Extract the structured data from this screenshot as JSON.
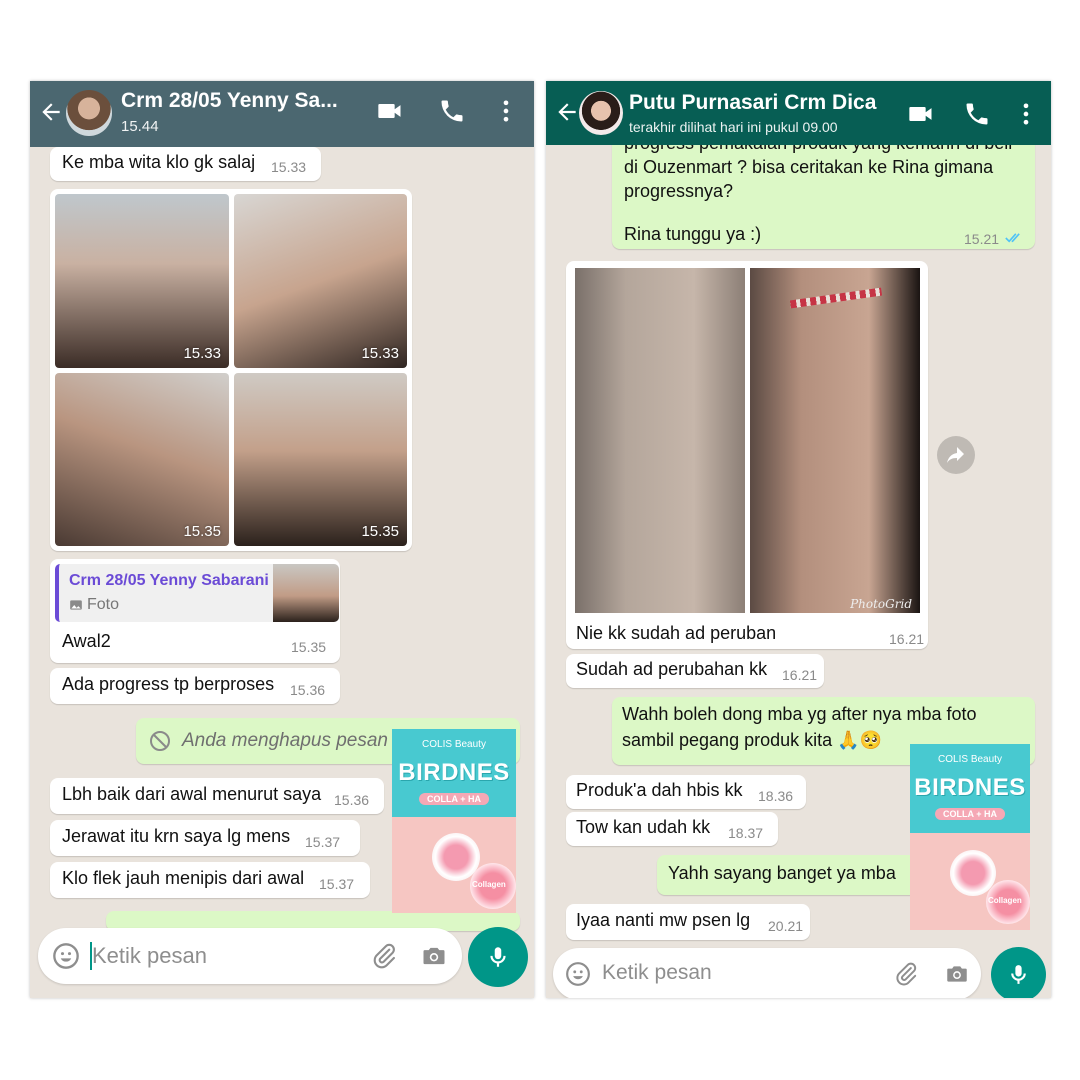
{
  "left": {
    "header": {
      "title": "Crm 28/05 Yenny Sa...",
      "subtitle": "15.44"
    },
    "messages": [
      {
        "text": "Ke mba wita klo gk salaj",
        "time": "15.33"
      },
      {
        "text": "Awal2",
        "time": "15.35"
      },
      {
        "text": "Ada progress tp berproses",
        "time": "15.36"
      },
      {
        "text": "Anda menghapus pesan"
      },
      {
        "text": "Lbh baik dari awal menurut saya",
        "time": "15.36"
      },
      {
        "text": "Jerawat itu krn saya lg mens",
        "time": "15.37"
      },
      {
        "text": "Klo flek jauh menipis dari awal",
        "time": "15.37"
      }
    ],
    "photos": [
      {
        "time": "15.33"
      },
      {
        "time": "15.33"
      },
      {
        "time": "15.35"
      },
      {
        "time": "15.35"
      }
    ],
    "reply": {
      "author": "Crm 28/05 Yenny Sabarani",
      "type": "Foto"
    },
    "input": {
      "placeholder": "Ketik pesan"
    }
  },
  "right": {
    "header": {
      "title": "Putu Purnasari Crm Dica",
      "subtitle": "terakhir dilihat hari ini pukul 09.00"
    },
    "top_message": {
      "lines": [
        "progress pemakaian produk yang kemarin di beli",
        "di Ouzenmart ? bisa ceritakan ke Rina gimana",
        "progressnya?",
        "",
        "Rina tunggu ya :)"
      ],
      "time": "15.21"
    },
    "photo_message": {
      "caption": "Nie kk sudah ad peruban",
      "time": "16.21",
      "watermark": "PhotoGrid"
    },
    "messages": [
      {
        "text": "Sudah ad perubahan kk",
        "time": "16.21"
      },
      {
        "text": "Wahh boleh dong mba yg after nya mba foto",
        "text2": "sambil pegang produk kita 🙏🥺"
      },
      {
        "text": "Produk'a dah hbis kk",
        "time": "18.36"
      },
      {
        "text": "Tow kan udah kk",
        "time": "18.37"
      },
      {
        "text": "Yahh sayang banget ya mba"
      },
      {
        "text": "Iyaa nanti mw psen lg",
        "time": "20.21"
      }
    ],
    "input": {
      "placeholder": "Ketik pesan"
    }
  },
  "product": {
    "brand": "COLIS Beauty",
    "name": "BIRDNES",
    "pill": "COLLA + HA",
    "badge": "Collagen"
  },
  "colors": {
    "left_header": "#4b6770",
    "right_header": "#075e54",
    "outgoing": "#dcf8c6",
    "mic": "#009688",
    "tick": "#4fc3f7"
  }
}
